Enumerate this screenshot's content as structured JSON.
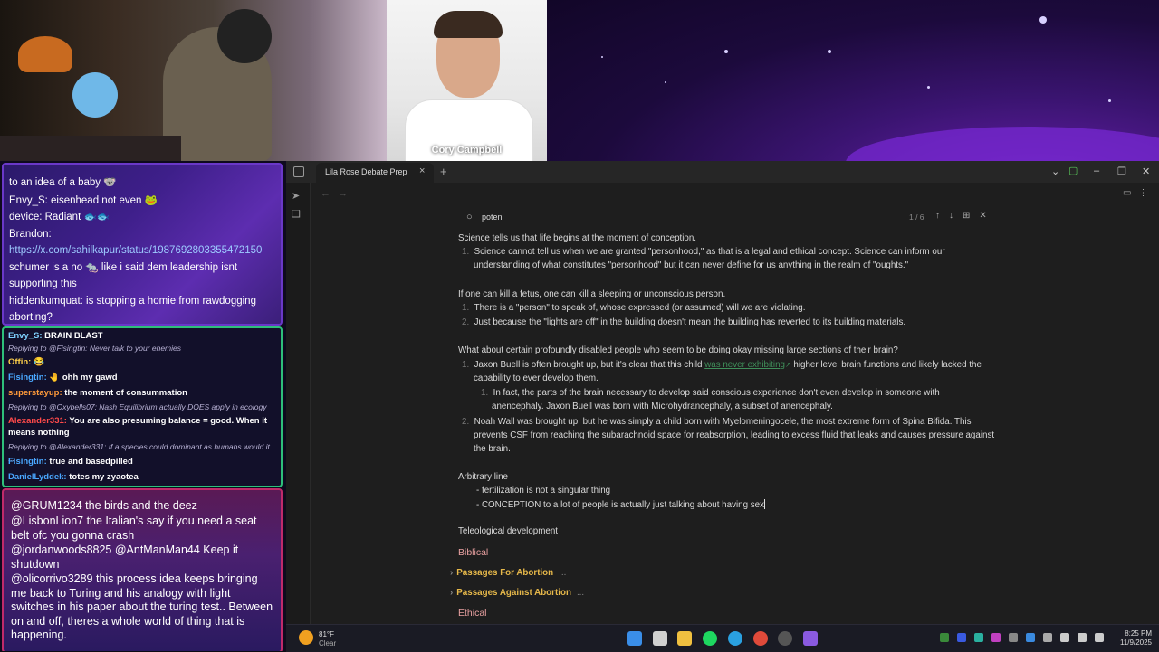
{
  "camera": {
    "guest_name": "Cory Campbell"
  },
  "chat_top": [
    {
      "text": "to an idea of a baby 🐨"
    },
    {
      "text": "Envy_S: eisenhead not even 🐸"
    },
    {
      "text": "device: Radiant 🐟🐟"
    },
    {
      "text": "Brandon:"
    },
    {
      "text": "https://x.com/sahilkapur/status/1987692803355472150",
      "link": true
    },
    {
      "text": "schumer is a no 🐀 like i said dem leadership isnt"
    },
    {
      "text": "supporting this"
    },
    {
      "text": "hiddenkumquat: is stopping a homie from rawdogging"
    },
    {
      "text": "aborting?"
    }
  ],
  "chat_mid": [
    {
      "name": "Envy_S:",
      "name_color": "#7fd3ff",
      "msg": "BRAIN BLAST"
    },
    {
      "reply": "Replying to @Fisingtin: Never talk to your enemies"
    },
    {
      "name": "Offin:",
      "name_color": "#ffd04a",
      "msg": "😂"
    },
    {
      "name": "Fisingtin:",
      "name_color": "#4aa8ff",
      "msg": "🤚 ohh my gawd"
    },
    {
      "name": "superstayup:",
      "name_color": "#ff9a3a",
      "msg": "the moment of consummation"
    },
    {
      "reply": "Replying to @Oxybells07: Nash Equilibrium actually DOES apply in ecology"
    },
    {
      "name": "Alexander331:",
      "name_color": "#ff4a4a",
      "msg": "You are also presuming balance = good. When it means nothing"
    },
    {
      "reply": "Replying to @Alexander331: If a species could dominant as humans would it ..."
    },
    {
      "name": "Fisingtin:",
      "name_color": "#4aa8ff",
      "msg": "true and basedpilled"
    },
    {
      "name": "DanielLyddek:",
      "name_color": "#4aa8ff",
      "msg": "totes my zyaotea"
    }
  ],
  "chat_bottom": [
    "@GRUM1234 the birds and the deez",
    "@LisbonLion7 the Italian's say if you need a seat belt ofc you gonna crash",
    "@jordanwoods8825 @AntManMan44 Keep it shutdown",
    "@olicorrivo3289 this process idea keeps bringing me back to Turing and his analogy with light switches in his paper about the turing test.. Between on and off, theres a whole world of thing that is happening."
  ],
  "app": {
    "tab_title": "Lila Rose Debate Prep",
    "search": {
      "query": "poten",
      "count": "1 / 6"
    }
  },
  "doc": {
    "p1_head": "Science tells us that life begins at the moment of conception.",
    "p1_items": [
      "Science cannot tell us when we are granted \"personhood,\" as that is a legal and ethical concept. Science can inform our",
      "understanding of what constitutes \"personhood\" but it can never define for us anything in the realm of \"oughts.\""
    ],
    "p2_head": "If one can kill a fetus, one can kill a sleeping or unconscious person.",
    "p2_items": [
      "There is a \"person\" to speak of, whose expressed (or assumed) will we are violating.",
      "Just because the \"lights are off\" in the building doesn't mean the building has reverted to its building materials."
    ],
    "p3_head": "What about certain profoundly disabled people who seem to be doing okay missing large sections of their brain?",
    "p3_item1_a": "Jaxon Buell is often brought up, but it's clear that this child",
    "p3_item1_link": "was never exhibiting",
    "p3_item1_b": "higher level brain functions and likely lacked the",
    "p3_item1_c": "capability to ever develop them.",
    "p3_sub_a": "In fact, the parts of the brain necessary to develop said conscious experience don't even develop in someone with",
    "p3_sub_b": "anencephaly. Jaxon Buell was born with Microhydrancephaly, a subset of anencephaly.",
    "p3_item2_a": "Noah Wall was brought up, but he was simply a child born with Myelomeningocele, the most extreme form of Spina Bifida. This",
    "p3_item2_b": "prevents CSF from reaching the subarachnoid space for reabsorption, leading to excess fluid that leaks and causes pressure against",
    "p3_item2_c": "the brain.",
    "arb_head": "Arbitrary line",
    "arb_items": [
      "- fertilization is not a singular thing",
      "- CONCEPTION to a lot of people is actually just talking about having sex"
    ],
    "teleo": "Teleological development",
    "biblical": "Biblical",
    "fold1": "Passages For Abortion",
    "fold2": "Passages Against Abortion",
    "ethical": "Ethical",
    "fold_dots": "..."
  },
  "taskbar": {
    "weather_temp": "81°F",
    "weather_cond": "Clear",
    "time": "8:25 PM",
    "date": "11/9/2025"
  },
  "colors": {
    "accent_link": "#3f8f5a",
    "heading_fold": "#e6b84a",
    "heading_biblical": "#e8a0a0"
  }
}
